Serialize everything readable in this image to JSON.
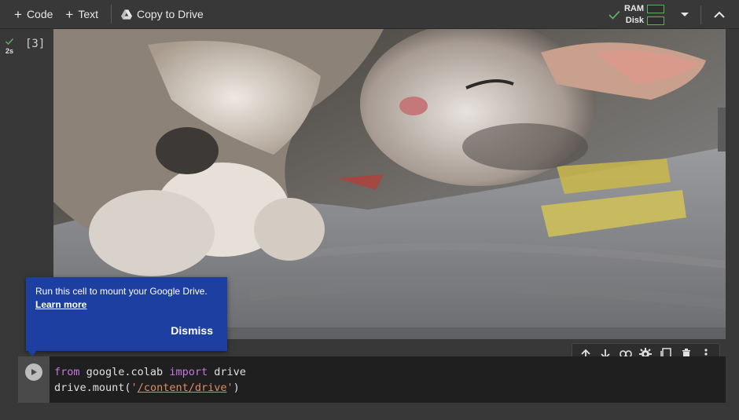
{
  "toolbar": {
    "add_code_label": "Code",
    "add_text_label": "Text",
    "copy_to_drive_label": "Copy to Drive",
    "ram_label": "RAM",
    "disk_label": "Disk",
    "ram_usage": 0,
    "disk_usage": 0
  },
  "output_cell": {
    "exec_time": "2s",
    "exec_count": "[3]",
    "image_subject": "sleeping kitten photo"
  },
  "code_cell": {
    "lines": [
      [
        "from",
        " google.colab ",
        "import",
        " drive"
      ],
      [
        "drive.mount(",
        "'",
        "/content/drive",
        "'",
        ")"
      ]
    ]
  },
  "tooltip": {
    "message": "Run this cell to mount your Google Drive.",
    "link": "Learn more",
    "dismiss": "Dismiss"
  },
  "colors": {
    "accent_green": "#5fae5f",
    "tooltip_bg": "#1e3fa2",
    "keyword": "#c678dd",
    "string": "#e28964"
  },
  "icons": [
    "plus-icon",
    "drive-icon",
    "check-icon",
    "dropdown-icon",
    "collapse-icon",
    "arrow-up-icon",
    "arrow-down-icon",
    "link-icon",
    "gear-icon",
    "mirror-cell-icon",
    "trash-icon",
    "more-vert-icon",
    "play-icon"
  ]
}
